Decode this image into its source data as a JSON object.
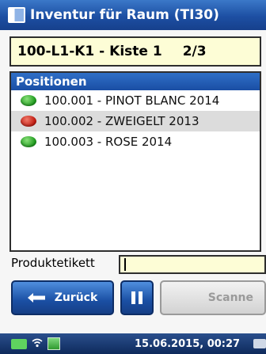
{
  "window": {
    "title": "Inventur für Raum (TI30)"
  },
  "location": {
    "code": "100-L1-K1 - Kiste 1",
    "counter": "2/3"
  },
  "positions": {
    "header": "Positionen",
    "items": [
      {
        "label": "100.001 - PINOT BLANC 2014",
        "status": "green"
      },
      {
        "label": "100.002 - ZWEIGELT 2013",
        "status": "red"
      },
      {
        "label": "100.003 - ROSE 2014",
        "status": "green"
      }
    ]
  },
  "product_label": {
    "label": "Produktetikett",
    "value": ""
  },
  "buttons": {
    "back": "Zurück",
    "scan": "Scanne"
  },
  "statusbar": {
    "datetime": "15.06.2015, 00:27"
  },
  "colors": {
    "ok": "#1d9a1d",
    "error": "#c01a10",
    "accent": "#1a4fa3",
    "field": "#fdfdd6"
  }
}
